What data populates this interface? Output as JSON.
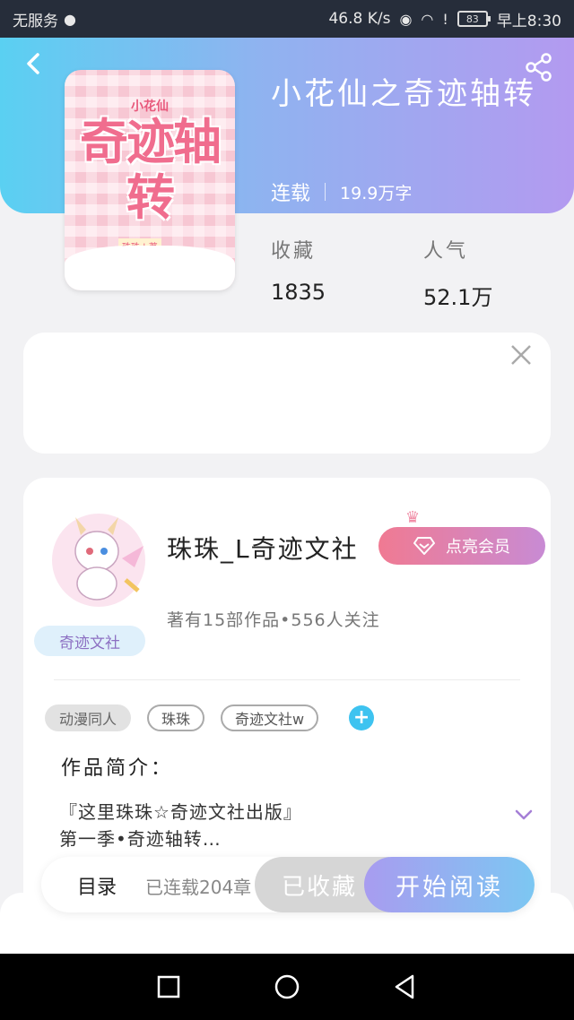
{
  "status_bar": {
    "carrier": "无服务",
    "speed": "46.8 K/s",
    "battery": "83",
    "time": "早上8:30"
  },
  "book": {
    "title": "小花仙之奇迹轴转",
    "status": "连载",
    "word_count": "19.9万字",
    "cover": {
      "small_text": "小花仙",
      "title": "奇迹轴转",
      "tag": "珠珠 | 著"
    }
  },
  "stats": {
    "favorites_label": "收藏",
    "favorites_value": "1835",
    "popularity_label": "人气",
    "popularity_value": "52.1万"
  },
  "author": {
    "name": "珠珠_L奇迹文社",
    "badge": "奇迹文社",
    "stats": "著有15部作品•556人关注",
    "member_button": "点亮会员"
  },
  "tags": [
    "动漫同人",
    "珠珠",
    "奇迹文社w"
  ],
  "intro": {
    "title": "作品简介：",
    "line1": "『这里珠珠☆奇迹文社出版』",
    "line2": "第一季•奇迹轴转…"
  },
  "actions": {
    "toc": "目录",
    "toc_count": "已连载204章",
    "collected": "已收藏",
    "start_reading": "开始阅读"
  },
  "colors": {
    "header_gradient_start": "#5ad0f2",
    "header_gradient_end": "#b39af0",
    "accent_blue": "#3ec3f0",
    "member_pink": "#f07a92"
  },
  "icons": [
    "back-arrow-icon",
    "share-icon",
    "close-icon",
    "diamond-icon",
    "crown-icon",
    "plus-icon",
    "chevron-down-icon",
    "nav-recent-icon",
    "nav-home-icon",
    "nav-back-icon"
  ]
}
